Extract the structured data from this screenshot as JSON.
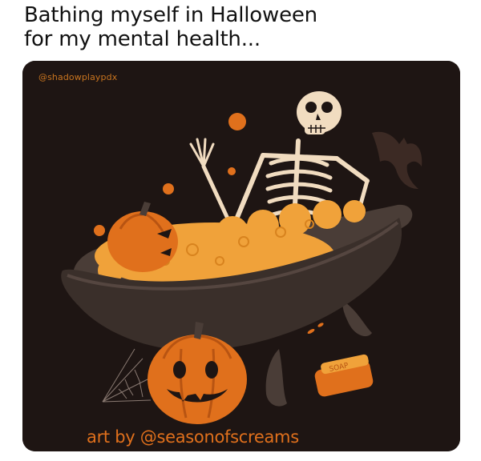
{
  "post": {
    "caption_line1": "Bathing myself in Halloween",
    "caption_line2": "for my mental health..."
  },
  "artwork": {
    "watermark_handle": "@shadowplaypdx",
    "credit": "art by @seasonofscreams",
    "soap_label": "SOAP",
    "colors": {
      "background": "#1e1513",
      "accent_orange": "#e0701c",
      "bubbles": "#f0a23a",
      "tub": "#3a2f2a",
      "bone": "#f1dcc0"
    }
  }
}
